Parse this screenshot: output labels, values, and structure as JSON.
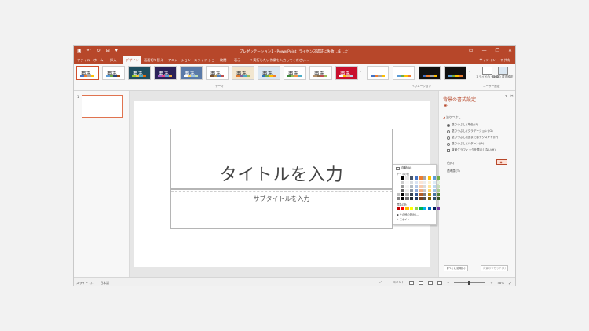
{
  "titlebar": {
    "title": "プレゼンテーション1 - PowerPoint (ライセンス認証に失敗しました)",
    "minimize": "—",
    "restore": "❐",
    "close": "✕"
  },
  "tabs": [
    "ファイル",
    "ホーム",
    "挿入",
    "デザイン",
    "画面切り替え",
    "アニメーション",
    "スライド ショー",
    "校閲",
    "表示"
  ],
  "active_tab": "デザイン",
  "tellme_placeholder": "♀ 実行したい作業を入力してください...",
  "signin": "サインイン",
  "share": "共有",
  "ribbon": {
    "theme_sample": "亜あ",
    "group_theme": "テーマ",
    "group_variant": "バリエーション",
    "group_custom": "ユーザー設定",
    "slide_size": "スライドの サイズ",
    "bg_format": "背景の 書式設定"
  },
  "thumb_number": "1",
  "slide": {
    "title_placeholder": "タイトルを入力",
    "subtitle_placeholder": "サブタイトルを入力"
  },
  "pane": {
    "title": "背景の書式設定",
    "section": "塗りつぶし",
    "options": [
      "塗りつぶし (単色)(S)",
      "塗りつぶし (グラデーション)(G)",
      "塗りつぶし (図またはテクスチャ)(P)",
      "塗りつぶし (パターン)(A)",
      "背景グラフィックを表示しない(H)"
    ],
    "color_label": "色(C)",
    "transparency_label": "透明度(T)",
    "apply_all": "すべてに適用(L)",
    "reset": "背景のリセット(B)"
  },
  "palette": {
    "automatic": "自動(A)",
    "theme_colors": "テーマの色",
    "standard_colors": "標準の色",
    "more_colors": "その他の色(M)...",
    "eyedropper": "スポイト"
  },
  "status": {
    "slide": "スライド 1/1",
    "lang": "日本語",
    "notes": "ノート",
    "comments": "コメント",
    "zoom": "58%"
  },
  "colors": {
    "accent": "#b7472a",
    "theme_row": [
      "#ffffff",
      "#000000",
      "#e7e6e6",
      "#44546a",
      "#4472c4",
      "#ed7d31",
      "#a5a5a5",
      "#ffc000",
      "#5b9bd5",
      "#70ad47"
    ],
    "standard_row": [
      "#c00000",
      "#ff0000",
      "#ffc000",
      "#ffff00",
      "#92d050",
      "#00b050",
      "#00b0f0",
      "#0070c0",
      "#002060",
      "#7030a0"
    ]
  }
}
